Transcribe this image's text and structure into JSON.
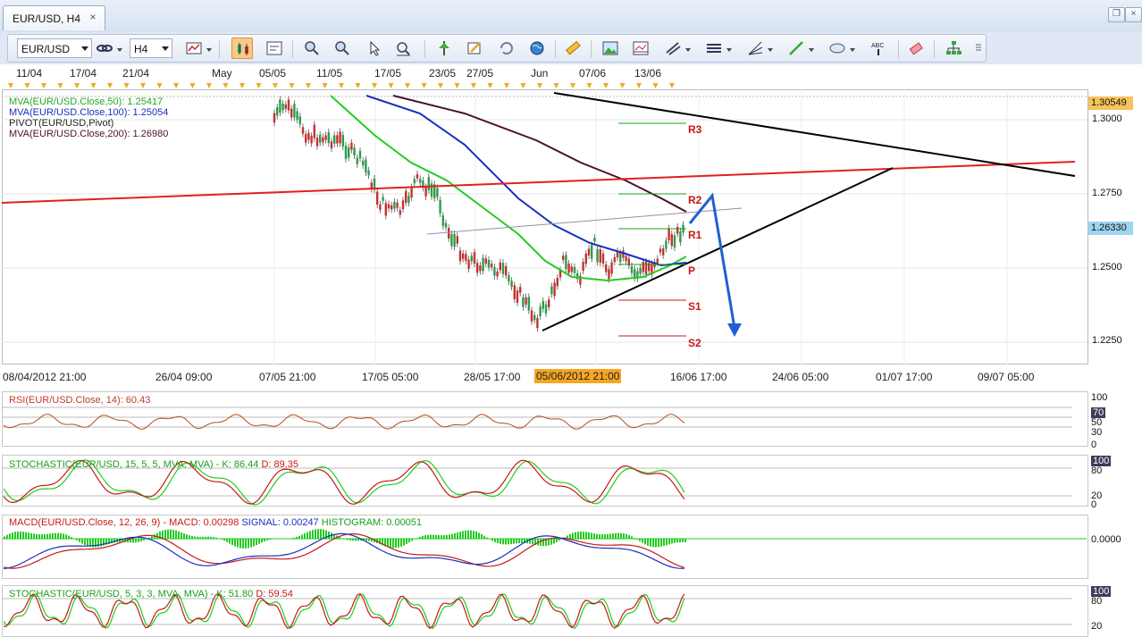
{
  "tab": {
    "title": "EUR/USD, H4",
    "close": "×"
  },
  "window": {
    "restore": "❐",
    "close": "×"
  },
  "toolbar": {
    "symbol": "EUR/USD",
    "timeframe": "H4"
  },
  "top_dates": [
    "11/04",
    "17/04",
    "21/04",
    "May",
    "05/05",
    "11/05",
    "17/05",
    "23/05",
    "27/05",
    "Jun",
    "07/06",
    "13/06"
  ],
  "main": {
    "legend": [
      {
        "text": "MVA(EUR/USD.Close,50): 1.25417",
        "color": "#22aa22"
      },
      {
        "text": "MVA(EUR/USD.Close,100): 1.25054",
        "color": "#1a2fbf"
      },
      {
        "text": "PIVOT(EUR/USD,Pivot)",
        "color": "#222222"
      },
      {
        "text": "MVA(EUR/USD.Close,200): 1.26980",
        "color": "#4a1030"
      }
    ],
    "price_labels": [
      "1.3000",
      "1.2750",
      "1.2500",
      "1.2250"
    ],
    "current_high": "1.30549",
    "current_price": "1.26330",
    "pivot_labels": [
      "R3",
      "R2",
      "R1",
      "P",
      "S1",
      "S2"
    ],
    "time_labels": [
      "08/04/2012 21:00",
      "26/04 09:00",
      "07/05 21:00",
      "17/05 05:00",
      "28/05 17:00",
      "16/06 17:00",
      "24/06 05:00",
      "01/07 17:00",
      "09/07 05:00"
    ],
    "time_highlight": "05/06/2012 21:00"
  },
  "rsi": {
    "label": "RSI(EUR/USD.Close, 14): 60.43",
    "scale": [
      "100",
      "70",
      "50",
      "30",
      "0"
    ]
  },
  "stoch1": {
    "l1": "STOCHASTIC(EUR/USD, 15, 5, 5, MVA, MVA)",
    "l2": "-",
    "k": "K: 86.44",
    "d": "D: 89.35",
    "scale": [
      "100",
      "80",
      "20",
      "0"
    ]
  },
  "macd": {
    "l1": "MACD(EUR/USD.Close, 12, 26, 9)",
    "l2": "-",
    "macd": "MACD: 0.00298",
    "signal": "SIGNAL: 0.00247",
    "hist": "HISTOGRAM: 0.00051",
    "scale": [
      "0.0000"
    ]
  },
  "stoch2": {
    "l1": "STOCHASTIC(EUR/USD, 5, 3, 3, MVA, MVA)",
    "l2": "-",
    "k": "K: 51.80",
    "d": "D: 59.54",
    "scale": [
      "100",
      "80",
      "20"
    ]
  },
  "colors": {
    "accent_orange": "#f5a623",
    "red_line": "#e02020",
    "green_ma": "#22cc22",
    "blue_ma": "#1a2fbf",
    "arrow": "#1f5fd6"
  }
}
